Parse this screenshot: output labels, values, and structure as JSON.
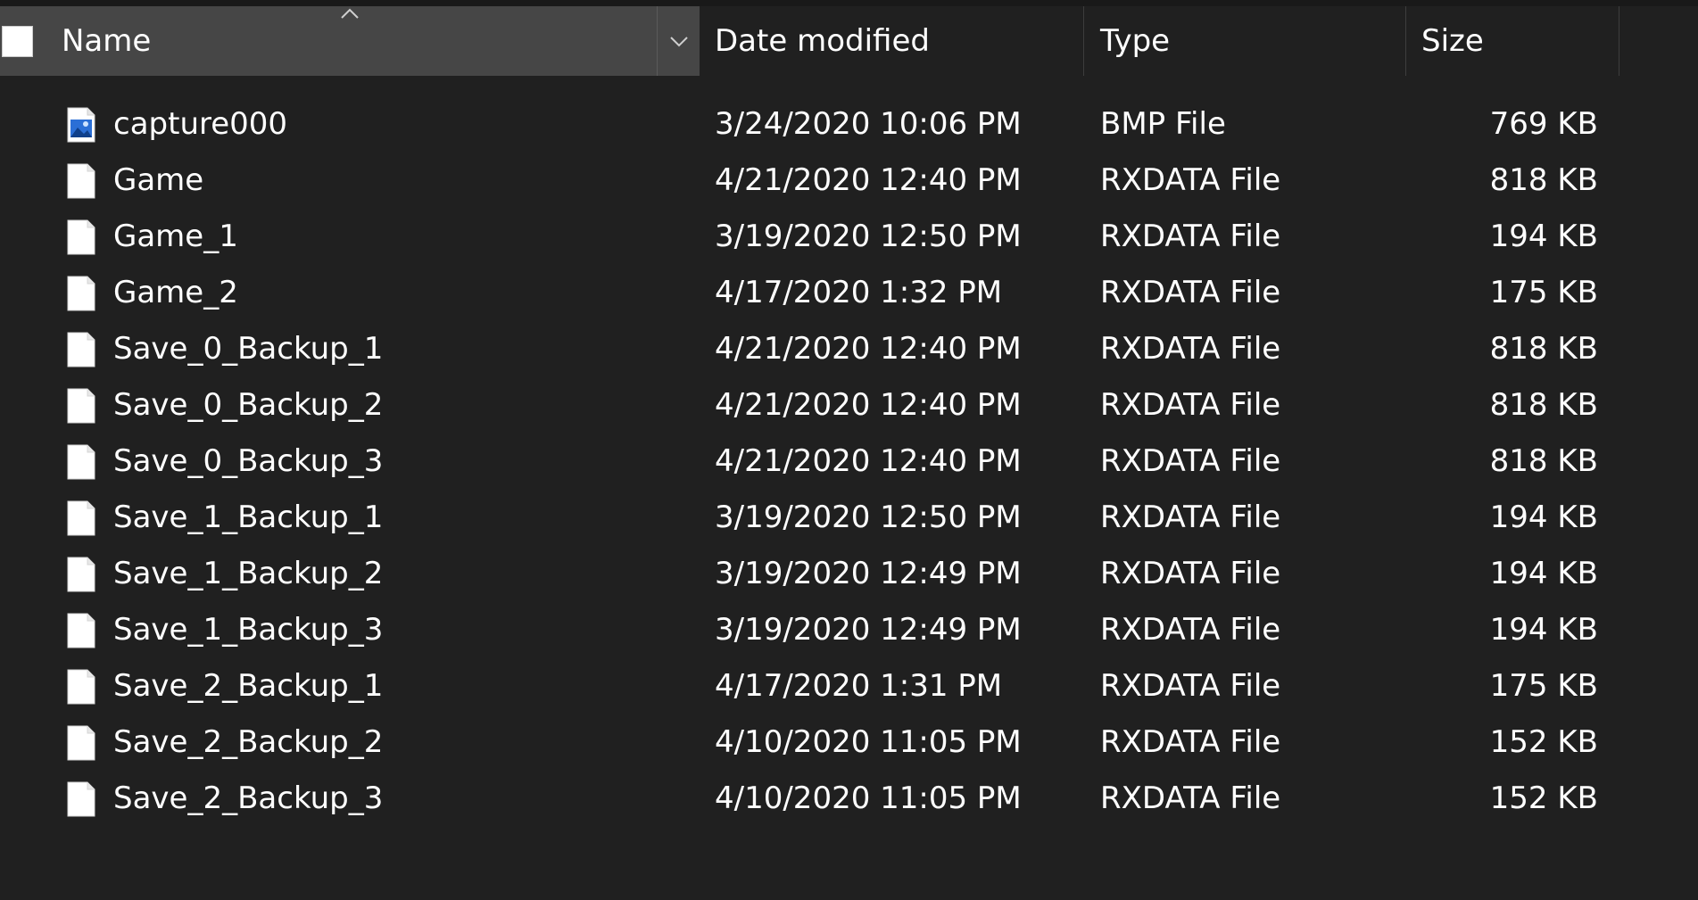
{
  "columns": {
    "name": "Name",
    "date": "Date modified",
    "type": "Type",
    "size": "Size"
  },
  "icons": {
    "sort": "chevron-up-icon",
    "dropdown": "chevron-down-icon",
    "bmp": "image-file-icon",
    "generic": "blank-file-icon"
  },
  "colors": {
    "background": "#202020",
    "header_active": "#464646",
    "text": "#ffffff"
  },
  "files": [
    {
      "name": "capture000",
      "date": "3/24/2020 10:06 PM",
      "type": "BMP File",
      "size": "769 KB",
      "icon": "bmp"
    },
    {
      "name": "Game",
      "date": "4/21/2020 12:40 PM",
      "type": "RXDATA File",
      "size": "818 KB",
      "icon": "generic"
    },
    {
      "name": "Game_1",
      "date": "3/19/2020 12:50 PM",
      "type": "RXDATA File",
      "size": "194 KB",
      "icon": "generic"
    },
    {
      "name": "Game_2",
      "date": "4/17/2020 1:32 PM",
      "type": "RXDATA File",
      "size": "175 KB",
      "icon": "generic"
    },
    {
      "name": "Save_0_Backup_1",
      "date": "4/21/2020 12:40 PM",
      "type": "RXDATA File",
      "size": "818 KB",
      "icon": "generic"
    },
    {
      "name": "Save_0_Backup_2",
      "date": "4/21/2020 12:40 PM",
      "type": "RXDATA File",
      "size": "818 KB",
      "icon": "generic"
    },
    {
      "name": "Save_0_Backup_3",
      "date": "4/21/2020 12:40 PM",
      "type": "RXDATA File",
      "size": "818 KB",
      "icon": "generic"
    },
    {
      "name": "Save_1_Backup_1",
      "date": "3/19/2020 12:50 PM",
      "type": "RXDATA File",
      "size": "194 KB",
      "icon": "generic"
    },
    {
      "name": "Save_1_Backup_2",
      "date": "3/19/2020 12:49 PM",
      "type": "RXDATA File",
      "size": "194 KB",
      "icon": "generic"
    },
    {
      "name": "Save_1_Backup_3",
      "date": "3/19/2020 12:49 PM",
      "type": "RXDATA File",
      "size": "194 KB",
      "icon": "generic"
    },
    {
      "name": "Save_2_Backup_1",
      "date": "4/17/2020 1:31 PM",
      "type": "RXDATA File",
      "size": "175 KB",
      "icon": "generic"
    },
    {
      "name": "Save_2_Backup_2",
      "date": "4/10/2020 11:05 PM",
      "type": "RXDATA File",
      "size": "152 KB",
      "icon": "generic"
    },
    {
      "name": "Save_2_Backup_3",
      "date": "4/10/2020 11:05 PM",
      "type": "RXDATA File",
      "size": "152 KB",
      "icon": "generic"
    }
  ]
}
